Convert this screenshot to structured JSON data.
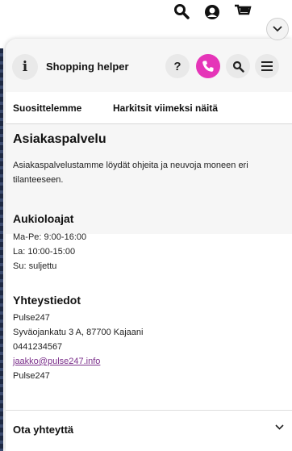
{
  "site_header": {
    "icons": [
      "search-icon",
      "account-icon",
      "cart-icon",
      "chevron-down-icon"
    ]
  },
  "widget": {
    "title": "Shopping helper",
    "info_glyph": "i",
    "help_glyph": "?",
    "accent_color": "#e535b8",
    "tabs": [
      {
        "label": "Suosittelemme"
      },
      {
        "label": "Harkitsit viimeksi näitä"
      }
    ],
    "customer_service": {
      "title": "Asiakaspalvelu",
      "description": "Asiakaspalvelustamme löydät ohjeita ja neuvoja moneen eri tilanteeseen."
    },
    "opening_hours": {
      "title": "Aukioloajat",
      "lines": [
        "Ma-Pe: 9:00-16:00",
        "La: 10:00-15:00",
        "Su: suljettu"
      ]
    },
    "contact_info": {
      "title": "Yhteystiedot",
      "name": "Pulse247",
      "address": "Syväojankatu 3 A, 87700 Kajaani",
      "phone": "0441234567",
      "email": "jaakko@pulse247.info",
      "company": "Pulse247"
    },
    "contact_section": {
      "label": "Ota yhteyttä"
    }
  }
}
